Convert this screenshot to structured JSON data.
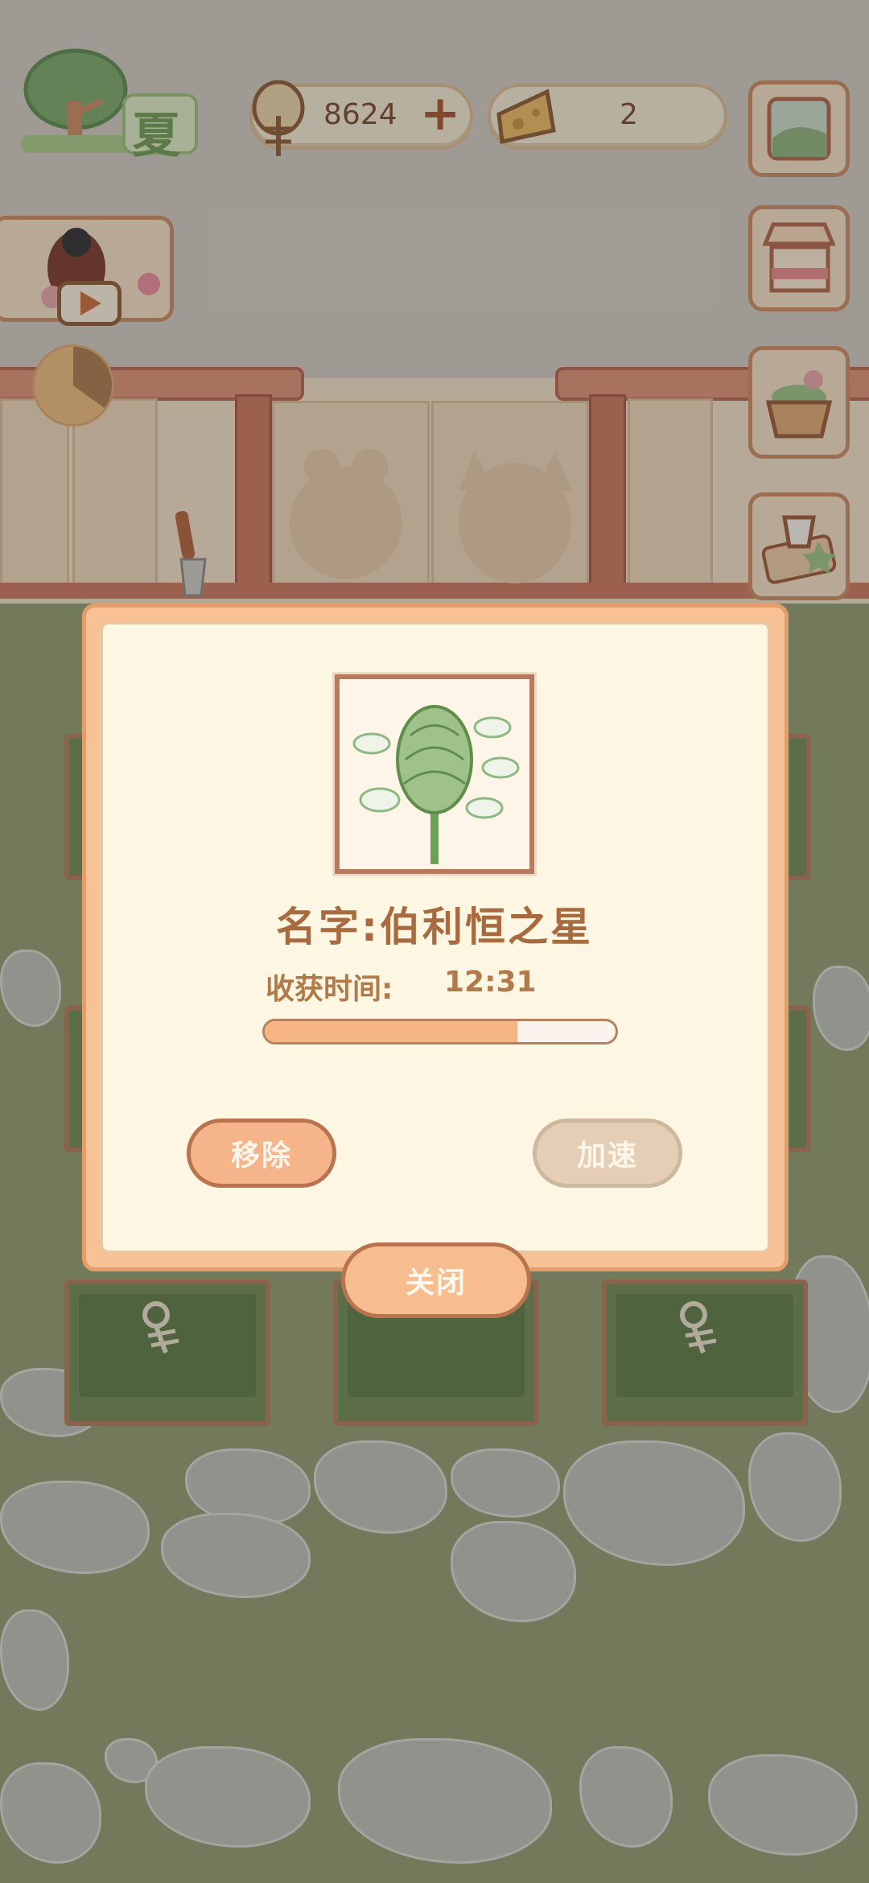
{
  "hud": {
    "season_label": "夏",
    "fish_count": "8624",
    "fish_add_symbol": "+",
    "cheese_count": "2"
  },
  "dialog": {
    "plant_name": "名字:伯利恒之星",
    "harvest_label": "收获时间:",
    "harvest_time": "12:31",
    "progress": 0.72,
    "remove_label": "移除",
    "speed_label": "加速",
    "close_label": "关闭"
  },
  "colors": {
    "accent": "#f7bd8f",
    "border": "#b9744f",
    "text": "#a86a3f"
  }
}
